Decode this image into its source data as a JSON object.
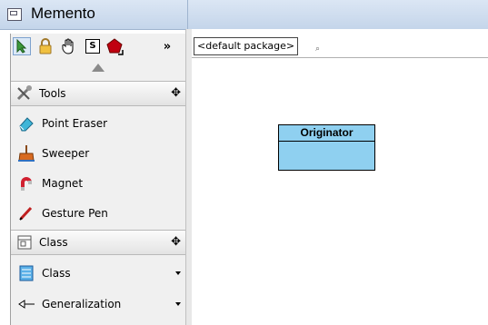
{
  "window": {
    "title": "Memento"
  },
  "toolbar": {
    "tools": [
      {
        "icon": "select-arrow-icon",
        "selected": true
      },
      {
        "icon": "lock-icon"
      },
      {
        "icon": "pan-hand-icon"
      },
      {
        "icon": "s-icon",
        "label": "S"
      },
      {
        "icon": "shape-icon"
      },
      {
        "icon": "more-chevron-icon",
        "label": "»"
      }
    ]
  },
  "palette": {
    "groups": [
      {
        "title": "Tools",
        "items": [
          {
            "label": "Point Eraser"
          },
          {
            "label": "Sweeper"
          },
          {
            "label": "Magnet"
          },
          {
            "label": "Gesture Pen"
          }
        ]
      },
      {
        "title": "Class",
        "items": [
          {
            "label": "Class"
          },
          {
            "label": "Generalization"
          }
        ]
      }
    ]
  },
  "diagram": {
    "package_tab": "<default package>",
    "class_box": {
      "name": "Originator",
      "fill": "#8fd0f0"
    }
  }
}
